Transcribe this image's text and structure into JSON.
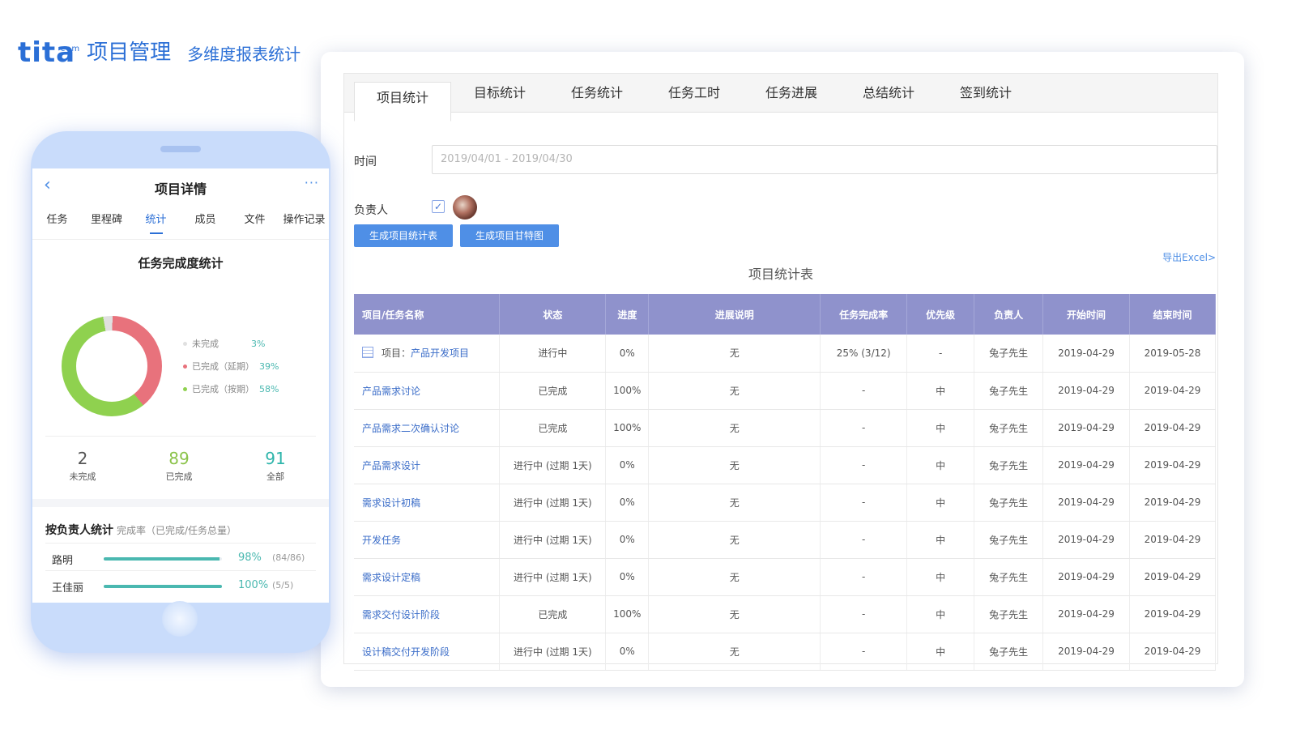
{
  "brand": {
    "logo": "tita",
    "logo_suffix": "com",
    "product": "项目管理",
    "tagline": "多维度报表统计",
    "color": "#2b6fd6"
  },
  "desktop": {
    "tabs": [
      "项目统计",
      "目标统计",
      "任务统计",
      "任务工时",
      "任务进展",
      "总结统计",
      "签到统计"
    ],
    "active_tab": "项目统计",
    "time_label": "时间",
    "time_value": "2019/04/01 - 2019/04/30",
    "owner_label": "负责人",
    "btn_generate_table": "生成项目统计表",
    "btn_generate_gantt": "生成项目甘特图",
    "export_link": "导出Excel>",
    "table_title": "项目统计表",
    "columns": [
      "项目/任务名称",
      "状态",
      "进度",
      "进展说明",
      "任务完成率",
      "优先级",
      "负责人",
      "开始时间",
      "结束时间"
    ],
    "project_row": {
      "prefix": "项目：",
      "name": "产品开发项目",
      "status": "进行中",
      "progress": "0%",
      "note": "无",
      "completion": "25%  (3/12)",
      "priority": "-",
      "owner": "兔子先生",
      "start": "2019-04-29",
      "end": "2019-05-28"
    },
    "rows": [
      {
        "name": "产品需求讨论",
        "status": "已完成",
        "progress": "100%",
        "note": "无",
        "completion": "-",
        "priority": "中",
        "owner": "兔子先生",
        "start": "2019-04-29",
        "end": "2019-04-29"
      },
      {
        "name": "产品需求二次确认讨论",
        "status": "已完成",
        "progress": "100%",
        "note": "无",
        "completion": "-",
        "priority": "中",
        "owner": "兔子先生",
        "start": "2019-04-29",
        "end": "2019-04-29"
      },
      {
        "name": "产品需求设计",
        "status": "进行中  (过期 1天)",
        "progress": "0%",
        "note": "无",
        "completion": "-",
        "priority": "中",
        "owner": "兔子先生",
        "start": "2019-04-29",
        "end": "2019-04-29"
      },
      {
        "name": "需求设计初稿",
        "status": "进行中  (过期 1天)",
        "progress": "0%",
        "note": "无",
        "completion": "-",
        "priority": "中",
        "owner": "兔子先生",
        "start": "2019-04-29",
        "end": "2019-04-29"
      },
      {
        "name": "开发任务",
        "status": "进行中  (过期 1天)",
        "progress": "0%",
        "note": "无",
        "completion": "-",
        "priority": "中",
        "owner": "兔子先生",
        "start": "2019-04-29",
        "end": "2019-04-29"
      },
      {
        "name": "需求设计定稿",
        "status": "进行中  (过期 1天)",
        "progress": "0%",
        "note": "无",
        "completion": "-",
        "priority": "中",
        "owner": "兔子先生",
        "start": "2019-04-29",
        "end": "2019-04-29"
      },
      {
        "name": "需求交付设计阶段",
        "status": "已完成",
        "progress": "100%",
        "note": "无",
        "completion": "-",
        "priority": "中",
        "owner": "兔子先生",
        "start": "2019-04-29",
        "end": "2019-04-29"
      },
      {
        "name": "设计稿交付开发阶段",
        "status": "进行中  (过期 1天)",
        "progress": "0%",
        "note": "无",
        "completion": "-",
        "priority": "中",
        "owner": "兔子先生",
        "start": "2019-04-29",
        "end": "2019-04-29"
      }
    ]
  },
  "phone": {
    "title": "项目详情",
    "back_icon": "chevron-left-icon",
    "more_icon": "more-icon",
    "tabs": [
      "任务",
      "里程碑",
      "统计",
      "成员",
      "文件",
      "操作记录"
    ],
    "active_tab": "统计",
    "donut_title": "任务完成度统计",
    "legend": [
      {
        "label": "未完成",
        "pct": "3%",
        "color": "#e0e0e0"
      },
      {
        "label": "已完成（延期）",
        "pct": "39%",
        "color": "#e8727c"
      },
      {
        "label": "已完成（按期）",
        "pct": "58%",
        "color": "#8fd14f"
      }
    ],
    "stats": [
      {
        "num": "2",
        "label": "未完成",
        "color": "#555555"
      },
      {
        "num": "89",
        "label": "已完成",
        "color": "#8bc34a"
      },
      {
        "num": "91",
        "label": "全部",
        "color": "#2fb5ab"
      }
    ],
    "by_owner_title": "按负责人统计",
    "by_owner_sub": "完成率（已完成/任务总量）",
    "owners": [
      {
        "name": "路明",
        "pct": "98%",
        "count": "(84/86)",
        "fill": 0.98
      },
      {
        "name": "王佳丽",
        "pct": "100%",
        "count": "(5/5)",
        "fill": 1.0
      }
    ]
  }
}
